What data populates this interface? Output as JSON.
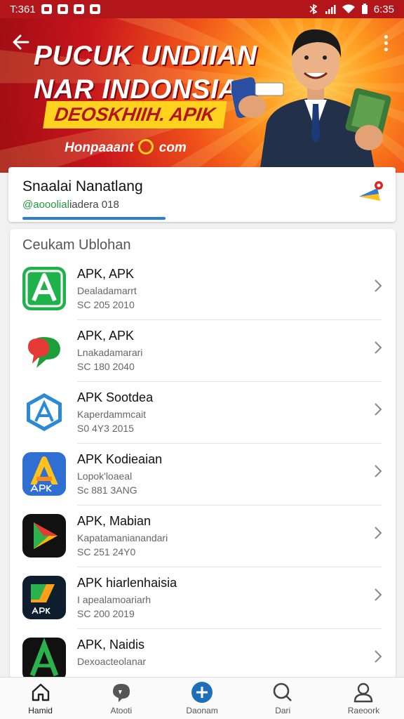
{
  "status_bar": {
    "time_left": "T:361",
    "time_right": "6:35"
  },
  "banner": {
    "title": "PUCUK UNDIIAN NAR INDONSIA",
    "subtitle": "DEOSKHIIH. APIK",
    "link_prefix": "Honpaaant",
    "link_suffix": "com"
  },
  "profile": {
    "name": "Snaalai Nanatlang",
    "handle": "@aooolial",
    "handle_rest": "iadera 018",
    "progress": 0.37
  },
  "list": {
    "header": "Ceukam Ublohan",
    "apps": [
      {
        "title": "APK, APK",
        "developer": "Dealadamarrt",
        "meta": "SC 205 2010",
        "icon": "green-a-icon"
      },
      {
        "title": "APK, APK",
        "developer": "Lnakadamarari",
        "meta": "SC 180 2040",
        "icon": "chat-bubble-icon"
      },
      {
        "title": "APK Sootdea",
        "developer": "Kaperdammcait",
        "meta": "S0 4Y3 2015",
        "icon": "blue-hexagon-icon"
      },
      {
        "title": "APK Kodieaian",
        "developer": "Lopok'loaeal",
        "meta": "Sc 881 3ANG",
        "icon": "apk-a-icon"
      },
      {
        "title": "APK, Mabian",
        "developer": "Kapatamanianandari",
        "meta": "SC 251 24Y0",
        "icon": "play-triangle-icon"
      },
      {
        "title": "APK hiarlenhaisia",
        "developer": "I apealamoariarh",
        "meta": "SC 200 2019",
        "icon": "apk-dark-icon"
      },
      {
        "title": "APK, Naidis",
        "developer": "Dexoacteolanar",
        "meta": "",
        "icon": "green-a-dark-icon"
      }
    ]
  },
  "bottom_nav": [
    {
      "label": "Hamid",
      "icon": "home-icon"
    },
    {
      "label": "Atooti",
      "icon": "chat-icon"
    },
    {
      "label": "Daonam",
      "icon": "add-icon"
    },
    {
      "label": "Dari",
      "icon": "search-icon"
    },
    {
      "label": "Raeoork",
      "icon": "profile-icon"
    }
  ],
  "colors": {
    "brand_red": "#b3161a",
    "accent_yellow": "#ffd21f",
    "accent_blue": "#2d7fd6",
    "accent_green": "#1f9c3a"
  }
}
